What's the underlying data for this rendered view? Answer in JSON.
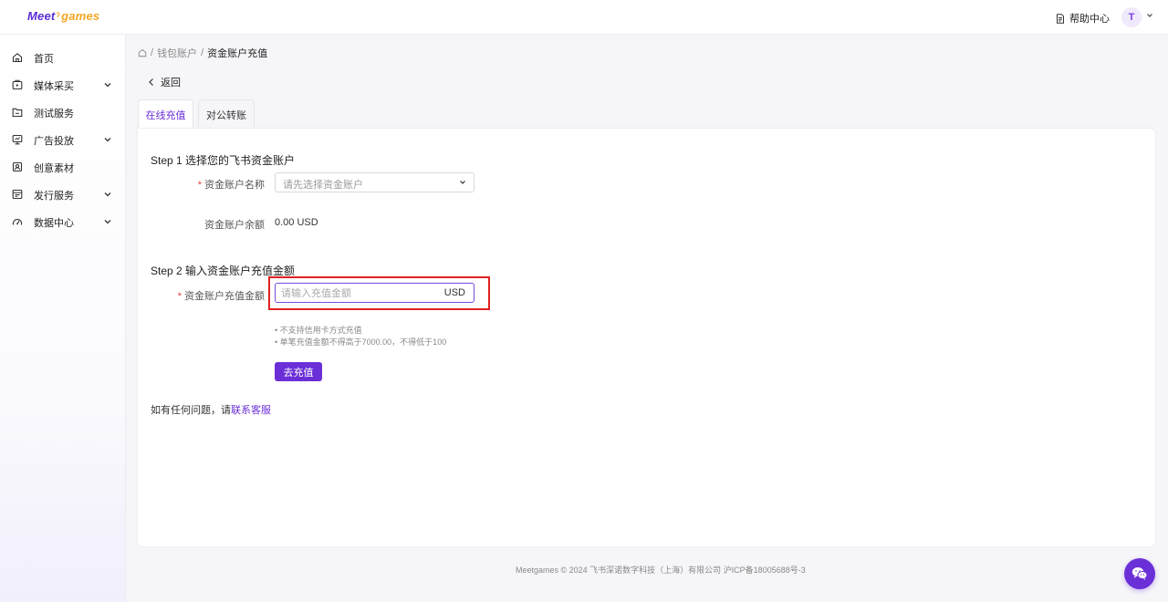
{
  "brand": {
    "logo_prefix": "Meet",
    "logo_suffix": "games",
    "accent": "#6b2fd8",
    "highlight": "#e02020"
  },
  "header": {
    "help_label": "帮助中心",
    "avatar_initial": "T"
  },
  "sidebar": {
    "items": [
      {
        "label": "首页",
        "icon": "home-icon",
        "expandable": false
      },
      {
        "label": "媒体采买",
        "icon": "media-icon",
        "expandable": true
      },
      {
        "label": "测试服务",
        "icon": "folder-icon",
        "expandable": false
      },
      {
        "label": "广告投放",
        "icon": "monitor-icon",
        "expandable": true
      },
      {
        "label": "创意素材",
        "icon": "image-icon",
        "expandable": false
      },
      {
        "label": "发行服务",
        "icon": "publish-icon",
        "expandable": true
      },
      {
        "label": "数据中心",
        "icon": "gauge-icon",
        "expandable": true
      }
    ]
  },
  "breadcrumb": {
    "sep": "/",
    "items": [
      "钱包账户",
      "资金账户充值"
    ]
  },
  "back_label": "返回",
  "tabs": [
    {
      "label": "在线充值",
      "active": true
    },
    {
      "label": "对公转账",
      "active": false
    }
  ],
  "step1": {
    "title": "Step 1 选择您的飞书资金账户",
    "account_label": "资金账户名称",
    "account_placeholder": "请先选择资金账户",
    "balance_label": "资金账户余额",
    "balance_value": "0.00 USD"
  },
  "step2": {
    "title": "Step 2 输入资金账户充值金额",
    "amount_label": "资金账户充值金额",
    "amount_placeholder": "请输入充值金额",
    "amount_value": "",
    "unit": "USD",
    "notes": [
      "• 不支持信用卡方式充值",
      "• 单笔充值金额不得高于7000.00，不得低于100"
    ],
    "submit_label": "去充值"
  },
  "contact": {
    "prefix": "如有任何问题，请",
    "link": "联系客服"
  },
  "footer": "Meetgames © 2024 飞书深诺数字科技（上海）有限公司 沪ICP备18005688号-3"
}
